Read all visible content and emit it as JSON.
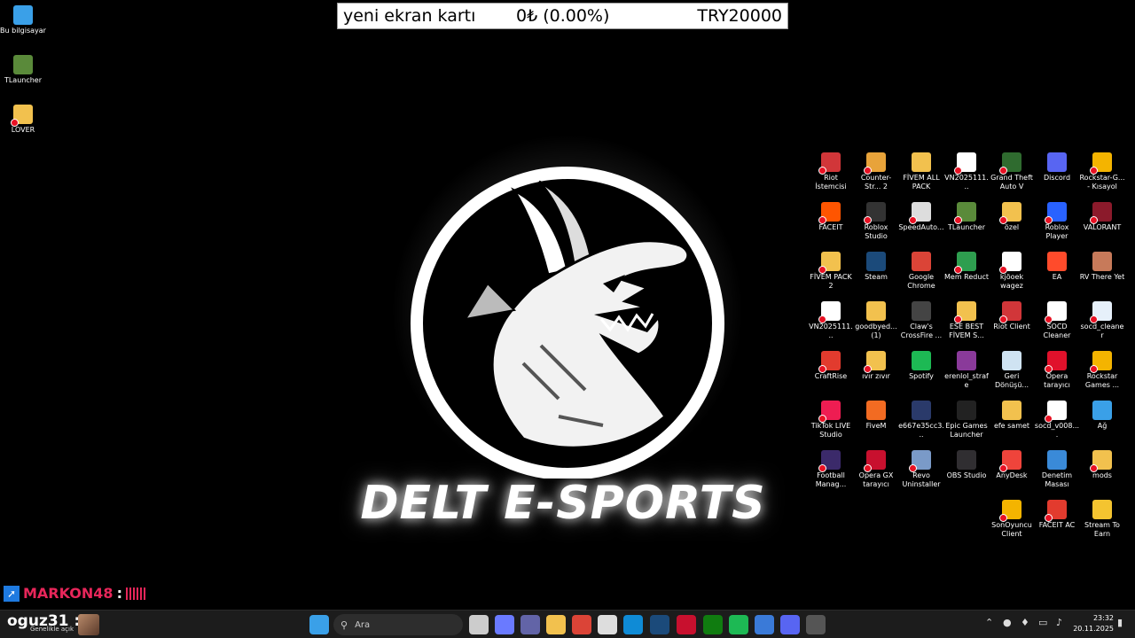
{
  "ticker": {
    "name": "yeni ekran kartı",
    "value": "0₺ (0.00%)",
    "target": "TRY20000"
  },
  "wallpaper": {
    "brand_text": "DELT E-SPORTS"
  },
  "left_icons": [
    {
      "label": "Bu bilgisayar",
      "icon": "computer-icon",
      "color": "#3aa0e8",
      "broken": false
    },
    {
      "label": "TLauncher",
      "icon": "minecraft-block-icon",
      "color": "#5a8a3a",
      "broken": false
    },
    {
      "label": "LOVER",
      "icon": "folder-icon",
      "color": "#f2c14e",
      "broken": true
    }
  ],
  "right_icons": [
    [
      {
        "label": "Riot İstemcisi",
        "icon": "riot-icon",
        "color": "#d13639",
        "broken": true
      },
      {
        "label": "Counter-Str... 2",
        "icon": "cs2-icon",
        "color": "#e8a33a",
        "broken": true
      },
      {
        "label": "FİVEM ALL PACK",
        "icon": "folder-icon",
        "color": "#f2c14e",
        "broken": false
      },
      {
        "label": "VN2025111...",
        "icon": "file-icon",
        "color": "#ffffff",
        "broken": true
      },
      {
        "label": "Grand Theft Auto V",
        "icon": "gta-icon",
        "color": "#2f6b2f",
        "broken": true
      },
      {
        "label": "Discord",
        "icon": "discord-icon",
        "color": "#5865f2",
        "broken": false
      },
      {
        "label": "Rockstar-G... - Kısayol",
        "icon": "rockstar-icon",
        "color": "#f4b400",
        "broken": true
      }
    ],
    [
      {
        "label": "FACEIT",
        "icon": "faceit-icon",
        "color": "#ff5500",
        "broken": true
      },
      {
        "label": "Roblox Studio",
        "icon": "roblox-studio-icon",
        "color": "#333333",
        "broken": true
      },
      {
        "label": "SpeedAuto...",
        "icon": "mouse-icon",
        "color": "#dddddd",
        "broken": true
      },
      {
        "label": "TLauncher",
        "icon": "minecraft-block-icon",
        "color": "#5a8a3a",
        "broken": true
      },
      {
        "label": "özel",
        "icon": "folder-icon",
        "color": "#f2c14e",
        "broken": true
      },
      {
        "label": "Roblox Player",
        "icon": "roblox-icon",
        "color": "#2962ff",
        "broken": true
      },
      {
        "label": "VALORANT",
        "icon": "valorant-icon",
        "color": "#8b1a2b",
        "broken": true
      }
    ],
    [
      {
        "label": "FİVEM PACK 2",
        "icon": "folder-icon",
        "color": "#f2c14e",
        "broken": true
      },
      {
        "label": "Steam",
        "icon": "steam-icon",
        "color": "#1b4a7a",
        "broken": false
      },
      {
        "label": "Google Chrome",
        "icon": "chrome-icon",
        "color": "#db4437",
        "broken": false
      },
      {
        "label": "Mem Reduct",
        "icon": "memory-icon",
        "color": "#2e9e4f",
        "broken": true
      },
      {
        "label": "kjöoek wagez",
        "icon": "file-icon",
        "color": "#ffffff",
        "broken": true
      },
      {
        "label": "EA",
        "icon": "ea-icon",
        "color": "#ff4b2b",
        "broken": false
      },
      {
        "label": "RV There Yet",
        "icon": "game-icon",
        "color": "#c77a5a",
        "broken": false
      }
    ],
    [
      {
        "label": "VN2025111...",
        "icon": "file-icon",
        "color": "#ffffff",
        "broken": true
      },
      {
        "label": "goodbyed... (1)",
        "icon": "folder-icon",
        "color": "#f2c14e",
        "broken": false
      },
      {
        "label": "Claw's CrossFire ...",
        "icon": "crosshair-icon",
        "color": "#444444",
        "broken": false
      },
      {
        "label": "ESE BEST FİVEM S...",
        "icon": "folder-icon",
        "color": "#f2c14e",
        "broken": true
      },
      {
        "label": "Riot Client",
        "icon": "riot-icon",
        "color": "#d13639",
        "broken": true
      },
      {
        "label": "SOCD Cleaner",
        "icon": "file-icon",
        "color": "#ffffff",
        "broken": true
      },
      {
        "label": "socd_cleaner",
        "icon": "window-icon",
        "color": "#e6f0fa",
        "broken": true
      }
    ],
    [
      {
        "label": "CraftRise",
        "icon": "craftrise-icon",
        "color": "#e23b2e",
        "broken": true
      },
      {
        "label": "ıvır zıvır",
        "icon": "folder-icon",
        "color": "#f2c14e",
        "broken": true
      },
      {
        "label": "Spotify",
        "icon": "spotify-icon",
        "color": "#1db954",
        "broken": false
      },
      {
        "label": "erenlol_strafe",
        "icon": "archive-icon",
        "color": "#8a3a9a",
        "broken": false
      },
      {
        "label": "Geri Dönüşü...",
        "icon": "recycle-bin-icon",
        "color": "#cfe3f2",
        "broken": false
      },
      {
        "label": "Opera tarayıcı",
        "icon": "opera-icon",
        "color": "#e0112b",
        "broken": true
      },
      {
        "label": "Rockstar Games ...",
        "icon": "rockstar-icon",
        "color": "#f4b400",
        "broken": true
      }
    ],
    [
      {
        "label": "TikTok LIVE Studio",
        "icon": "tiktok-icon",
        "color": "#ee1d52",
        "broken": true
      },
      {
        "label": "FiveM",
        "icon": "fivem-icon",
        "color": "#f26b22",
        "broken": false
      },
      {
        "label": "e667e35cc3...",
        "icon": "image-icon",
        "color": "#2a3a6a",
        "broken": false
      },
      {
        "label": "Epic Games Launcher",
        "icon": "epic-icon",
        "color": "#222222",
        "broken": false
      },
      {
        "label": "efe samet",
        "icon": "folder-icon",
        "color": "#f2c14e",
        "broken": false
      },
      {
        "label": "socd_v008....",
        "icon": "file-icon",
        "color": "#ffffff",
        "broken": true
      },
      {
        "label": "Ağ",
        "icon": "network-icon",
        "color": "#3aa0e8",
        "broken": false
      }
    ],
    [
      {
        "label": "Football Manag...",
        "icon": "football-manager-icon",
        "color": "#3b2a6a",
        "broken": true
      },
      {
        "label": "Opera GX tarayıcı",
        "icon": "opera-gx-icon",
        "color": "#c8102e",
        "broken": true
      },
      {
        "label": "Revo Uninstaller",
        "icon": "revo-icon",
        "color": "#7a9ac8",
        "broken": true
      },
      {
        "label": "OBS Studio",
        "icon": "obs-icon",
        "color": "#302e31",
        "broken": false
      },
      {
        "label": "AnyDesk",
        "icon": "anydesk-icon",
        "color": "#ef443b",
        "broken": true
      },
      {
        "label": "Denetim Masası",
        "icon": "control-panel-icon",
        "color": "#3a8ad8",
        "broken": false
      },
      {
        "label": "mods",
        "icon": "folder-icon",
        "color": "#f2c14e",
        "broken": true
      }
    ],
    [
      null,
      null,
      null,
      null,
      {
        "label": "SonOyuncu Client",
        "icon": "sonoyuncu-icon",
        "color": "#f4b400",
        "broken": true
      },
      {
        "label": "FACEIT AC",
        "icon": "faceit-ac-icon",
        "color": "#e23b2e",
        "broken": true
      },
      {
        "label": "Stream To Earn",
        "icon": "coin-icon",
        "color": "#f4c430",
        "broken": false
      }
    ]
  ],
  "overlay": {
    "name": "MARKON48",
    "separator": ":"
  },
  "taskbar": {
    "user_name": "oguz31",
    "user_separator": ":",
    "user_sub": "Genelikle açık",
    "search_placeholder": "Ara",
    "apps": [
      {
        "icon": "windows-start-icon",
        "color": "#3aa0e8"
      },
      {
        "icon": "task-view-icon",
        "color": "#cccccc"
      },
      {
        "icon": "copilot-icon",
        "color": "#6a7aff"
      },
      {
        "icon": "teams-icon",
        "color": "#6264a7"
      },
      {
        "icon": "file-explorer-icon",
        "color": "#f2c14e"
      },
      {
        "icon": "chrome-icon",
        "color": "#db4437"
      },
      {
        "icon": "microsoft-store-icon",
        "color": "#dddddd"
      },
      {
        "icon": "edge-icon",
        "color": "#0f8bd6"
      },
      {
        "icon": "steam-icon",
        "color": "#1b4a7a"
      },
      {
        "icon": "opera-gx-icon",
        "color": "#c8102e"
      },
      {
        "icon": "xbox-icon",
        "color": "#107c10"
      },
      {
        "icon": "spotify-icon",
        "color": "#1db954"
      },
      {
        "icon": "network-app-icon",
        "color": "#3a7ad8"
      },
      {
        "icon": "discord-icon",
        "color": "#5865f2"
      },
      {
        "icon": "obs-icon",
        "color": "#555555"
      }
    ],
    "tray": [
      "chevron-up-icon",
      "opera-tray-icon",
      "microphone-icon",
      "display-icon",
      "volume-icon"
    ],
    "time": "23:32",
    "date": "20.11.2025"
  }
}
